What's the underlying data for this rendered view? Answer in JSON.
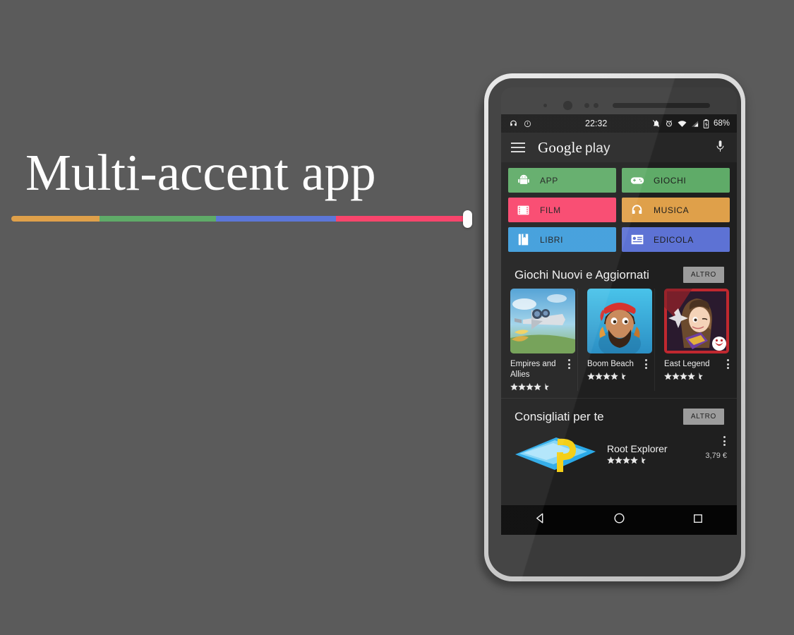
{
  "promo": {
    "headline": "Multi-accent app",
    "accent_segments": [
      {
        "name": "orange",
        "color": "#dfa04a"
      },
      {
        "name": "green",
        "color": "#5fab68"
      },
      {
        "name": "blue",
        "color": "#5c77d8"
      },
      {
        "name": "pink",
        "color": "#f9456c"
      }
    ],
    "handle_color": "#fdfdfd"
  },
  "phone": {
    "statusbar": {
      "time": "22:32",
      "battery_percent": "68%",
      "left_icons": [
        "headphones-icon",
        "info-circle-icon"
      ],
      "right_icons": [
        "bell-off-icon",
        "alarm-icon",
        "wifi-icon",
        "signal-icon",
        "battery-charging-icon"
      ]
    },
    "header": {
      "menu_icon": "hamburger-menu-icon",
      "logo_google": "Google",
      "logo_play": "play",
      "mic_icon": "microphone-icon"
    },
    "tiles": [
      {
        "label": "APP",
        "icon": "android-icon",
        "color": "#5fab68",
        "text_color": "#1d1d1d"
      },
      {
        "label": "GIOCHI",
        "icon": "gamepad-icon",
        "color": "#5fab68",
        "text_color": "#1d1d1d"
      },
      {
        "label": "FILM",
        "icon": "film-icon",
        "color": "#f9456c",
        "text_color": "#1d1d1d"
      },
      {
        "label": "MUSICA",
        "icon": "headphones-icon",
        "color": "#dfa04a",
        "text_color": "#1d1d1d"
      },
      {
        "label": "LIBRI",
        "icon": "book-icon",
        "color": "#3e9ddb",
        "text_color": "#1d1d1d"
      },
      {
        "label": "EDICOLA",
        "icon": "newspaper-icon",
        "color": "#5d72d4",
        "text_color": "#1d1d1d"
      }
    ],
    "sections": [
      {
        "title": "Giochi Nuovi e Aggiornati",
        "more_label": "ALTRO",
        "cards": [
          {
            "title": "Empires and Allies",
            "rating": 4.5,
            "overflow_icon": "overflow-menu-icon"
          },
          {
            "title": "Boom Beach",
            "rating": 4.5,
            "overflow_icon": "overflow-menu-icon"
          },
          {
            "title": "East Legend",
            "rating": 4.5,
            "overflow_icon": "overflow-menu-icon"
          }
        ]
      },
      {
        "title": "Consigliati per te",
        "more_label": "ALTRO",
        "item": {
          "name": "Root Explorer",
          "rating": 4.5,
          "price": "3,79 €",
          "overflow_icon": "overflow-menu-icon"
        }
      }
    ],
    "navbar": {
      "back_icon": "back-triangle-icon",
      "home_icon": "home-circle-icon",
      "recents_icon": "recents-square-icon"
    }
  }
}
